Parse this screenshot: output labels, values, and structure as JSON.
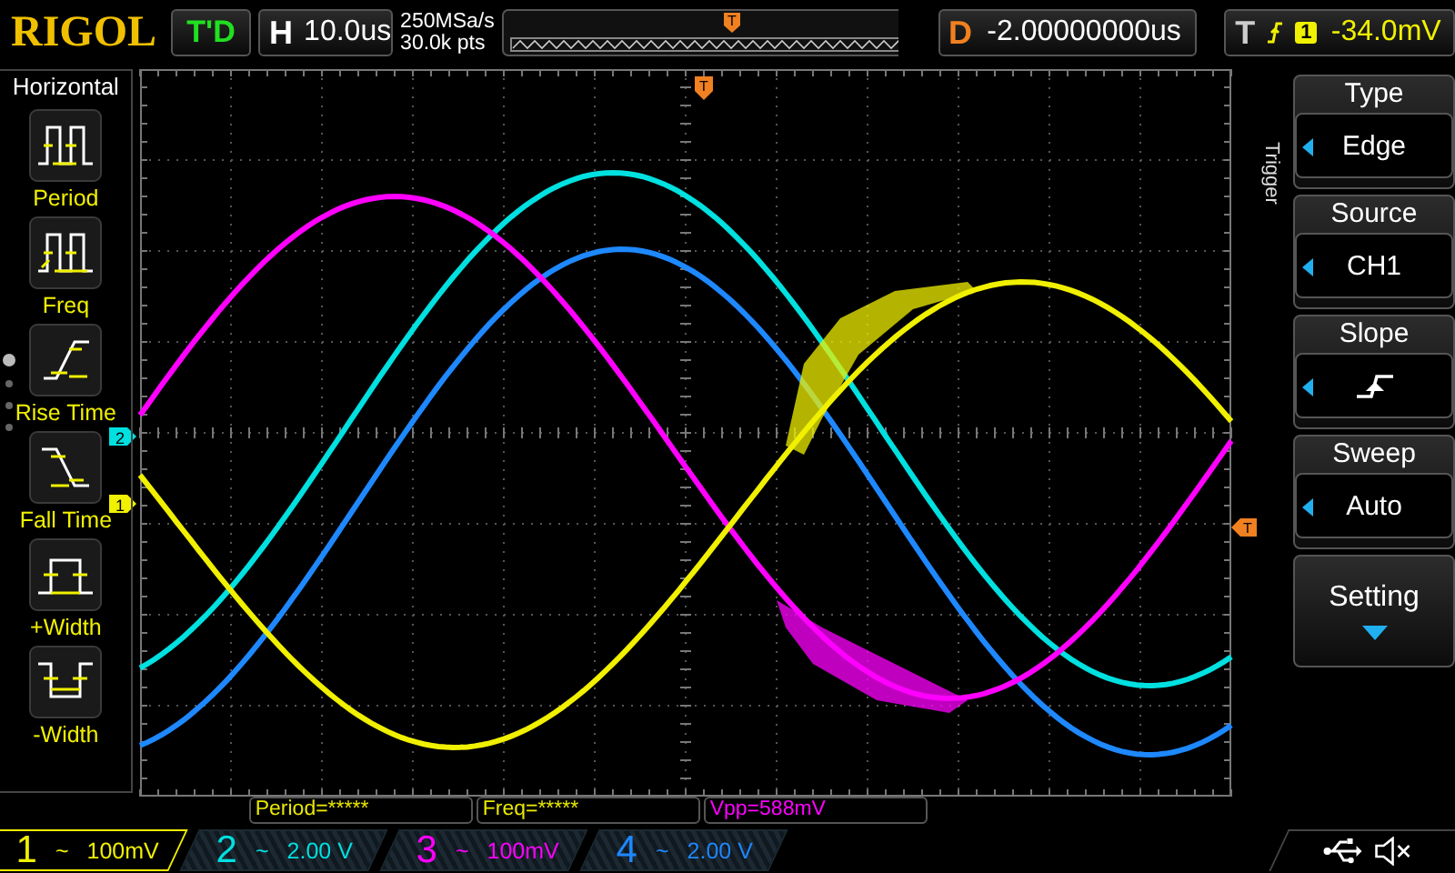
{
  "top_bar": {
    "logo": "RIGOL",
    "run_status": "T'D",
    "horizontal": {
      "label": "H",
      "timebase": "10.0us"
    },
    "sample_rate": "250MSa/s",
    "memory_depth": "30.0k pts",
    "memory_marker": "T",
    "delay": {
      "label": "D",
      "value": "-2.00000000us"
    },
    "trigger": {
      "label": "T",
      "source": "1",
      "level": "-34.0mV"
    }
  },
  "left_menu": {
    "title": "Horizontal",
    "items": [
      {
        "label": "Period",
        "kind": "period"
      },
      {
        "label": "Freq",
        "kind": "freq"
      },
      {
        "label": "Rise Time",
        "kind": "rise"
      },
      {
        "label": "Fall Time",
        "kind": "fall"
      },
      {
        "label": "+Width",
        "kind": "pwidth"
      },
      {
        "label": "-Width",
        "kind": "nwidth"
      }
    ]
  },
  "grid": {
    "trigger_position_marker": "T",
    "trigger_level_marker": "T",
    "channel_markers": [
      {
        "label": "2",
        "color": "#00e0e0"
      },
      {
        "label": "1",
        "color": "#f0f000"
      }
    ]
  },
  "measurements": [
    {
      "text": "Period=*****",
      "color": "#e8e800"
    },
    {
      "text": "Freq=*****",
      "color": "#e8e800"
    },
    {
      "text": "Vpp=588mV",
      "color": "#ff00ff"
    }
  ],
  "trigger_menu": {
    "title": "Trigger",
    "items": [
      {
        "label": "Type",
        "kind": "value",
        "value": "Edge"
      },
      {
        "label": "Source",
        "kind": "value",
        "value": "CH1"
      },
      {
        "label": "Slope",
        "kind": "slope"
      },
      {
        "label": "Sweep",
        "kind": "value",
        "value": "Auto"
      },
      {
        "label": "Setting",
        "kind": "submenu"
      }
    ]
  },
  "channels": [
    {
      "number": "1",
      "coupling": "~",
      "scale": "100mV",
      "color": "#f0f000",
      "selected": true
    },
    {
      "number": "2",
      "coupling": "~",
      "scale": "2.00 V",
      "color": "#00e0e0",
      "selected": false
    },
    {
      "number": "3",
      "coupling": "~",
      "scale": "100mV",
      "color": "#ff00ff",
      "selected": false
    },
    {
      "number": "4",
      "coupling": "~",
      "scale": "2.00 V",
      "color": "#1e88ff",
      "selected": false
    }
  ]
}
